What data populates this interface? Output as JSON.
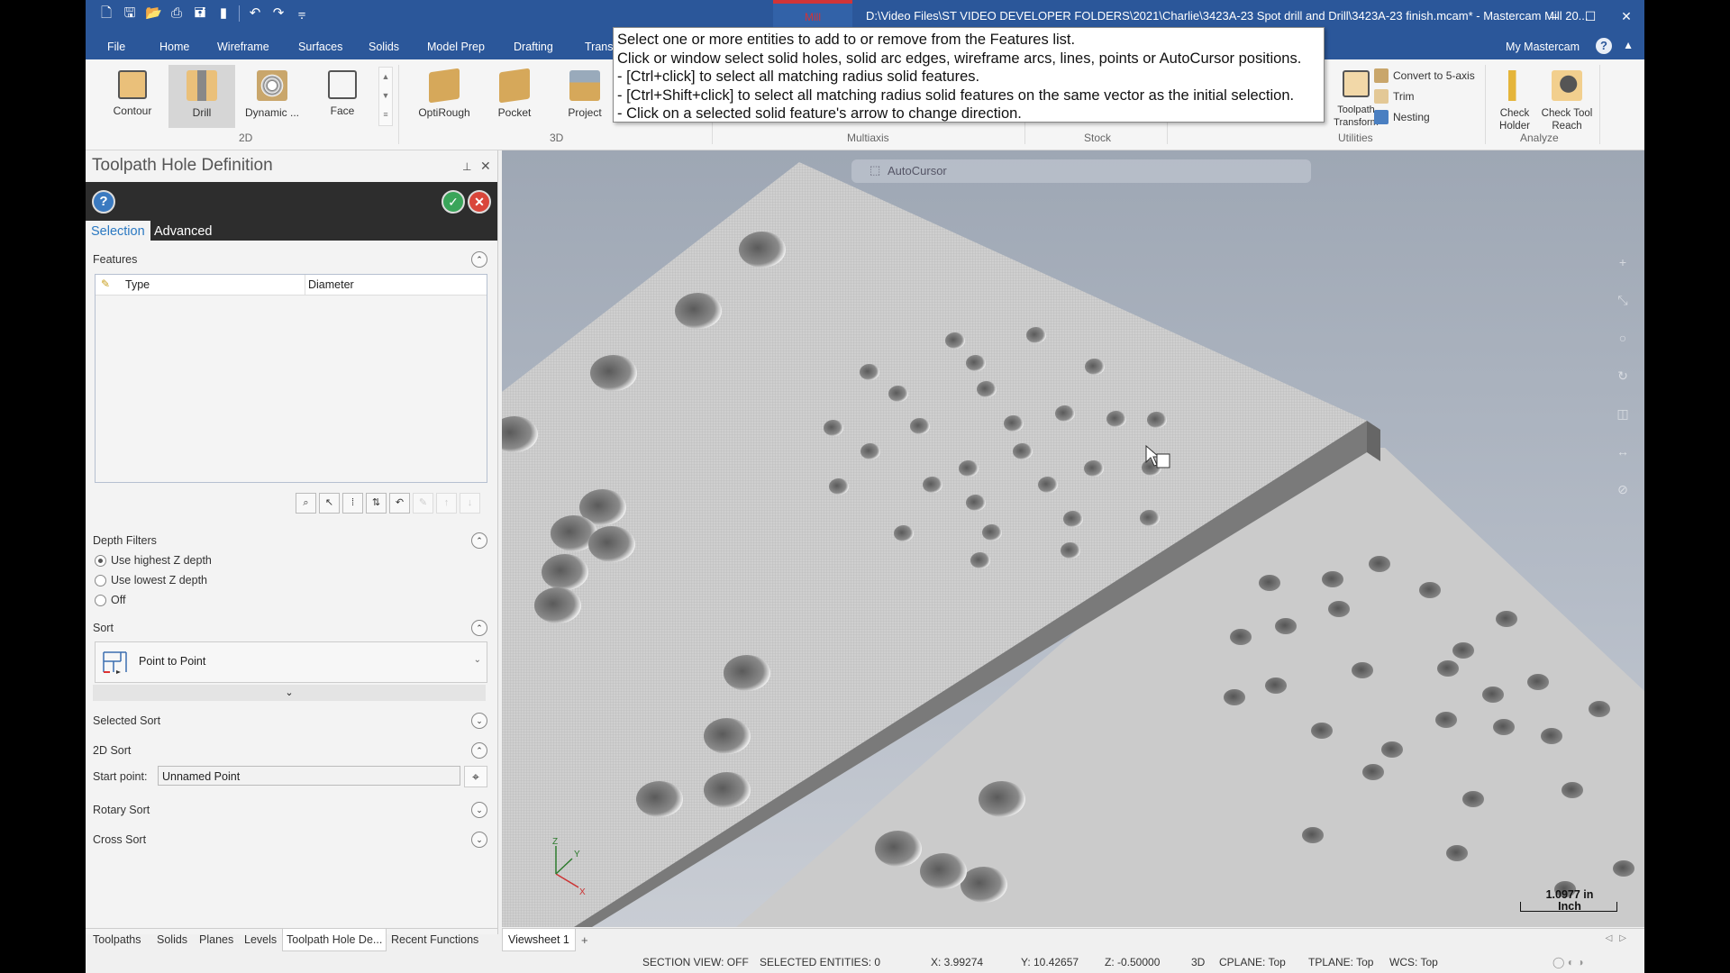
{
  "titlebar": {
    "quick_access": [
      "new-file",
      "save",
      "open",
      "print",
      "save-as",
      "properties",
      "undo",
      "redo",
      "customize"
    ],
    "context_tab": "Mill",
    "title": "D:\\Video Files\\ST VIDEO DEVELOPER FOLDERS\\2021\\Charlie\\3423A-23 Spot drill and Drill\\3423A-23 finish.mcam* - Mastercam Mill 20...",
    "controls": {
      "minimize": "–",
      "maximize": "☐",
      "close": "✕"
    }
  },
  "ribbon_tabs": [
    "File",
    "Home",
    "Wireframe",
    "Surfaces",
    "Solids",
    "Model Prep",
    "Drafting",
    "Trans"
  ],
  "ribbon_right": {
    "my_mastercam": "My Mastercam",
    "help": "?",
    "collapse": "▲"
  },
  "ribbon": {
    "groups": [
      {
        "label": "2D",
        "buttons": [
          "Contour",
          "Drill",
          "Dynamic ...",
          "Face"
        ],
        "active": "Drill"
      },
      {
        "label": "3D",
        "buttons": [
          "OptiRough",
          "Pocket",
          "Project"
        ]
      },
      {
        "label": "Multiaxis"
      },
      {
        "label": "Stock"
      },
      {
        "label": "Utilities",
        "buttons": [
          "Toolpath Transform"
        ],
        "small_buttons": [
          "Convert to 5-axis",
          "Trim",
          "Nesting"
        ]
      },
      {
        "label": "Analyze",
        "buttons": [
          "Check Holder",
          "Check Tool Reach"
        ]
      }
    ]
  },
  "tooltip": {
    "lines": [
      "Select one or more entities to add to or remove from the Features list.",
      "Click or window select solid holes, solid arc edges, wireframe arcs, lines, points or AutoCursor positions.",
      "- [Ctrl+click] to select all matching radius solid features.",
      "- [Ctrl+Shift+click] to select all matching radius solid features on the same vector as the initial selection.",
      "- Click on a selected solid feature's arrow to change direction."
    ]
  },
  "panel": {
    "title": "Toolpath Hole Definition",
    "pin": "⊥",
    "close": "✕",
    "tabs": [
      "Selection",
      "Advanced"
    ],
    "active_tab": "Selection",
    "features": {
      "label": "Features",
      "columns": [
        "Type",
        "Diameter"
      ],
      "rows": []
    },
    "list_tools": [
      "select",
      "reselect",
      "sort-list",
      "reverse",
      "undo",
      "edit",
      "move-up",
      "move-down"
    ],
    "depth_filters": {
      "label": "Depth Filters",
      "options": [
        "Use highest Z depth",
        "Use lowest Z depth",
        "Off"
      ],
      "selected": "Use highest Z depth"
    },
    "sort": {
      "label": "Sort",
      "value": "Point to Point"
    },
    "selected_sort": {
      "label": "Selected Sort"
    },
    "sort_2d": {
      "label": "2D Sort",
      "start_point_label": "Start point:",
      "start_point_value": "Unnamed Point"
    },
    "rotary_sort": {
      "label": "Rotary Sort"
    },
    "cross_sort": {
      "label": "Cross Sort"
    }
  },
  "bottom_tabs": [
    "Toolpaths",
    "Solids",
    "Planes",
    "Levels",
    "Toolpath Hole De...",
    "Recent Functions"
  ],
  "bottom_active": "Toolpath Hole De...",
  "viewsheets": {
    "tabs": [
      "Viewsheet 1"
    ],
    "add": "+"
  },
  "viewport": {
    "autocursor_label": "AutoCursor",
    "scale": {
      "value": "1.0977 in",
      "unit": "Inch"
    },
    "axes": [
      "X",
      "Y",
      "Z"
    ]
  },
  "status": {
    "section_view": "SECTION VIEW: OFF",
    "selected_entities": "SELECTED ENTITIES: 0",
    "x": "X:  3.99274",
    "y": "Y:  10.42657",
    "z": "Z:  -0.50000",
    "mode": "3D",
    "cplane": "CPLANE: Top",
    "tplane": "TPLANE: Top",
    "wcs": "WCS: Top"
  },
  "colors": {
    "accent": "#2b579a",
    "mill_tab": "#d13438",
    "selected_tab_text": "#2b79c2"
  }
}
